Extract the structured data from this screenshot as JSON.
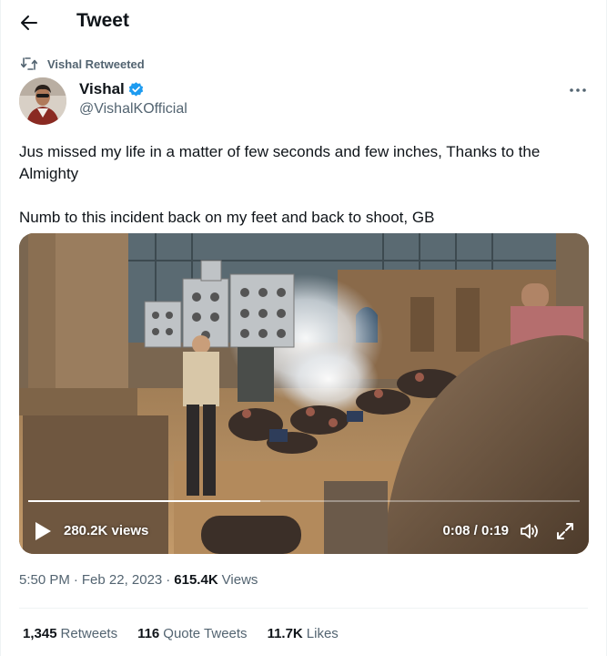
{
  "header": {
    "title": "Tweet"
  },
  "retweet": {
    "label": "Vishal Retweeted"
  },
  "author": {
    "name": "Vishal",
    "handle": "@VishalKOfficial"
  },
  "tweet": {
    "paragraph_1": "Jus missed my life in a matter of few seconds and few inches, Thanks to the Almighty",
    "paragraph_2": "Numb to this incident back on my feet and back to shoot, GB"
  },
  "video": {
    "views": "280.2K views",
    "time": "0:08 / 0:19",
    "progress": 0.42
  },
  "meta": {
    "time": "5:50 PM",
    "date": "Feb 22, 2023",
    "views_count": "615.4K",
    "views_label": "Views"
  },
  "stats": {
    "retweets_count": "1,345",
    "retweets_label": "Retweets",
    "quotes_count": "116",
    "quotes_label": "Quote Tweets",
    "likes_count": "11.7K",
    "likes_label": "Likes"
  },
  "colors": {
    "text_primary": "#0f1419",
    "text_secondary": "#536471",
    "verified_blue": "#1d9bf0",
    "divider": "#eff3f4"
  },
  "icons": {
    "back": "arrow-left-icon",
    "retweet": "retweet-icon",
    "verified": "verified-badge-icon",
    "more": "more-dots-icon",
    "play": "play-icon",
    "volume": "volume-icon",
    "expand": "fullscreen-icon"
  }
}
